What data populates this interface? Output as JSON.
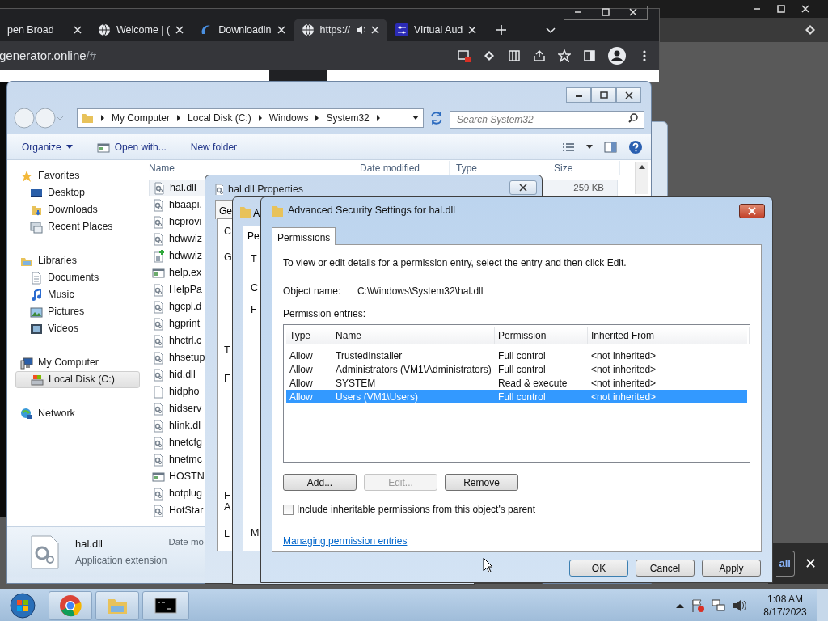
{
  "browser": {
    "tabs": [
      {
        "title": "pen Broad",
        "kind": "plain",
        "audio": false,
        "selected": false
      },
      {
        "title": "Welcome | (",
        "kind": "web",
        "audio": false,
        "selected": false
      },
      {
        "title": "Downloadin",
        "kind": "swirl",
        "audio": false,
        "selected": false
      },
      {
        "title": "https://",
        "kind": "web",
        "audio": true,
        "selected": true
      },
      {
        "title": "Virtual Aud",
        "kind": "mixer",
        "audio": false,
        "selected": false
      }
    ],
    "url_host": "generator.online",
    "url_rest": "/#"
  },
  "explorer": {
    "breadcrumb": [
      "My Computer",
      "Local Disk (C:)",
      "Windows",
      "System32"
    ],
    "search_placeholder": "Search System32",
    "toolbar": [
      "Organize",
      "Open with...",
      "New folder"
    ],
    "nav": [
      {
        "label": "Favorites",
        "kind": "star",
        "selected": false,
        "children": [
          {
            "label": "Desktop",
            "kind": "desktop",
            "selected": false
          },
          {
            "label": "Downloads",
            "kind": "download",
            "selected": false
          },
          {
            "label": "Recent Places",
            "kind": "recent",
            "selected": false
          }
        ]
      },
      {
        "label": "Libraries",
        "kind": "library",
        "selected": false,
        "children": [
          {
            "label": "Documents",
            "kind": "document",
            "selected": false
          },
          {
            "label": "Music",
            "kind": "music",
            "selected": false
          },
          {
            "label": "Pictures",
            "kind": "pictures",
            "selected": false
          },
          {
            "label": "Videos",
            "kind": "videos",
            "selected": false
          }
        ]
      },
      {
        "label": "My Computer",
        "kind": "computer",
        "selected": false,
        "children": [
          {
            "label": "Local Disk (C:)",
            "kind": "disk",
            "selected": true
          }
        ]
      },
      {
        "label": "Network",
        "kind": "network",
        "selected": false
      }
    ],
    "columns": [
      "Name",
      "Date modified",
      "Type",
      "Size"
    ],
    "files": [
      {
        "name": "hal.dll",
        "kind": "dll",
        "selected": true,
        "size": "259 KB"
      },
      {
        "name": "hbaapi.",
        "kind": "dll",
        "selected": false
      },
      {
        "name": "hcprovi",
        "kind": "dll",
        "selected": false
      },
      {
        "name": "hdwwiz",
        "kind": "dll",
        "selected": false
      },
      {
        "name": "hdwwiz",
        "kind": "setup",
        "selected": false
      },
      {
        "name": "help.ex",
        "kind": "exe",
        "selected": false
      },
      {
        "name": "HelpPa",
        "kind": "dll",
        "selected": false
      },
      {
        "name": "hgcpl.d",
        "kind": "dll",
        "selected": false
      },
      {
        "name": "hgprint",
        "kind": "dll",
        "selected": false
      },
      {
        "name": "hhctrl.c",
        "kind": "dll",
        "selected": false
      },
      {
        "name": "hhsetup",
        "kind": "dll",
        "selected": false
      },
      {
        "name": "hid.dll",
        "kind": "dll",
        "selected": false
      },
      {
        "name": "hidpho",
        "kind": "file",
        "selected": false
      },
      {
        "name": "hidserv",
        "kind": "dll",
        "selected": false
      },
      {
        "name": "hlink.dl",
        "kind": "dll",
        "selected": false
      },
      {
        "name": "hnetcfg",
        "kind": "dll",
        "selected": false
      },
      {
        "name": "hnetmc",
        "kind": "dll",
        "selected": false
      },
      {
        "name": "HOSTN",
        "kind": "exe",
        "selected": false
      },
      {
        "name": "hotplug",
        "kind": "dll",
        "selected": false
      },
      {
        "name": "HotStar",
        "kind": "dll",
        "selected": false
      }
    ],
    "details": {
      "name": "hal.dll",
      "type": "Application extension",
      "date_label": "Date mo"
    }
  },
  "properties": {
    "title": "hal.dll Properties",
    "tab": "Ge",
    "fragments": [
      "C",
      "G",
      "T",
      "F",
      "F",
      "A",
      "L"
    ]
  },
  "advanced_behind": {
    "title": "A",
    "tab": "Pe",
    "fragments": [
      "T",
      "C",
      "F",
      "M"
    ]
  },
  "advanced": {
    "title": "Advanced Security Settings for hal.dll",
    "tab": "Permissions",
    "intro": "To view or edit details for a permission entry, select the entry and then click Edit.",
    "object_label": "Object name:",
    "object_value": "C:\\Windows\\System32\\hal.dll",
    "entries_label": "Permission entries:",
    "columns": [
      "Type",
      "Name",
      "Permission",
      "Inherited From"
    ],
    "rows": [
      {
        "type": "Allow",
        "name": "TrustedInstaller",
        "permission": "Full control",
        "inherited": "<not inherited>",
        "selected": false
      },
      {
        "type": "Allow",
        "name": "Administrators (VM1\\Administrators)",
        "permission": "Full control",
        "inherited": "<not inherited>",
        "selected": false
      },
      {
        "type": "Allow",
        "name": "SYSTEM",
        "permission": "Read & execute",
        "inherited": "<not inherited>",
        "selected": false
      },
      {
        "type": "Allow",
        "name": "Users (VM1\\Users)",
        "permission": "Full control",
        "inherited": "<not inherited>",
        "selected": true
      }
    ],
    "entry_buttons": [
      {
        "label": "Add...",
        "disabled": false
      },
      {
        "label": "Edit...",
        "disabled": true
      },
      {
        "label": "Remove",
        "disabled": false
      }
    ],
    "inherit_checkbox": {
      "label": "Include inheritable permissions from this object's parent",
      "checked": false
    },
    "link": "Managing permission entries",
    "buttons": [
      "OK",
      "Cancel",
      "Apply"
    ]
  },
  "download_bar": {
    "button": "all",
    "close": "✕"
  },
  "taskbar": {
    "time": "1:08 AM",
    "date": "8/17/2023"
  }
}
